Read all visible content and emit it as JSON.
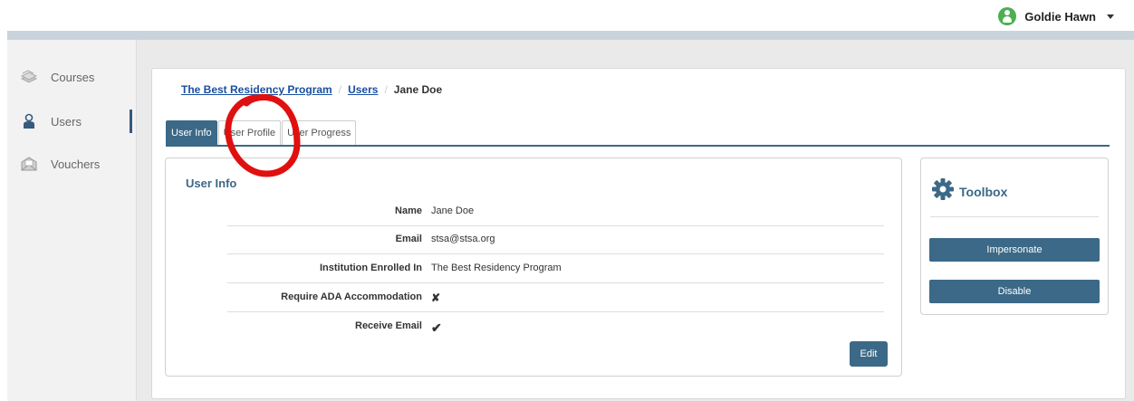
{
  "user_menu": {
    "name": "Goldie Hawn"
  },
  "sidebar": {
    "items": [
      {
        "label": "Courses"
      },
      {
        "label": "Users"
      },
      {
        "label": "Vouchers"
      }
    ]
  },
  "breadcrumb": {
    "program": "The Best Residency Program",
    "separator": "/",
    "users": "Users",
    "current": "Jane Doe"
  },
  "tabs": [
    {
      "label": "User Info"
    },
    {
      "label": "User Profile"
    },
    {
      "label": "User Progress"
    }
  ],
  "user_info": {
    "title": "User Info",
    "rows": [
      {
        "label": "Name",
        "value": "Jane Doe"
      },
      {
        "label": "Email",
        "value": "stsa@stsa.org"
      },
      {
        "label": "Institution Enrolled In",
        "value": "The Best Residency Program"
      },
      {
        "label": "Require ADA Accommodation",
        "value": "✘"
      },
      {
        "label": "Receive Email",
        "value": "✔"
      }
    ],
    "edit_label": "Edit"
  },
  "toolbox": {
    "title": "Toolbox",
    "impersonate_label": "Impersonate",
    "disable_label": "Disable"
  },
  "colors": {
    "accent": "#3b6987",
    "link": "#1a4fa0",
    "annotation": "#e01010",
    "avatar": "#4caf50"
  }
}
